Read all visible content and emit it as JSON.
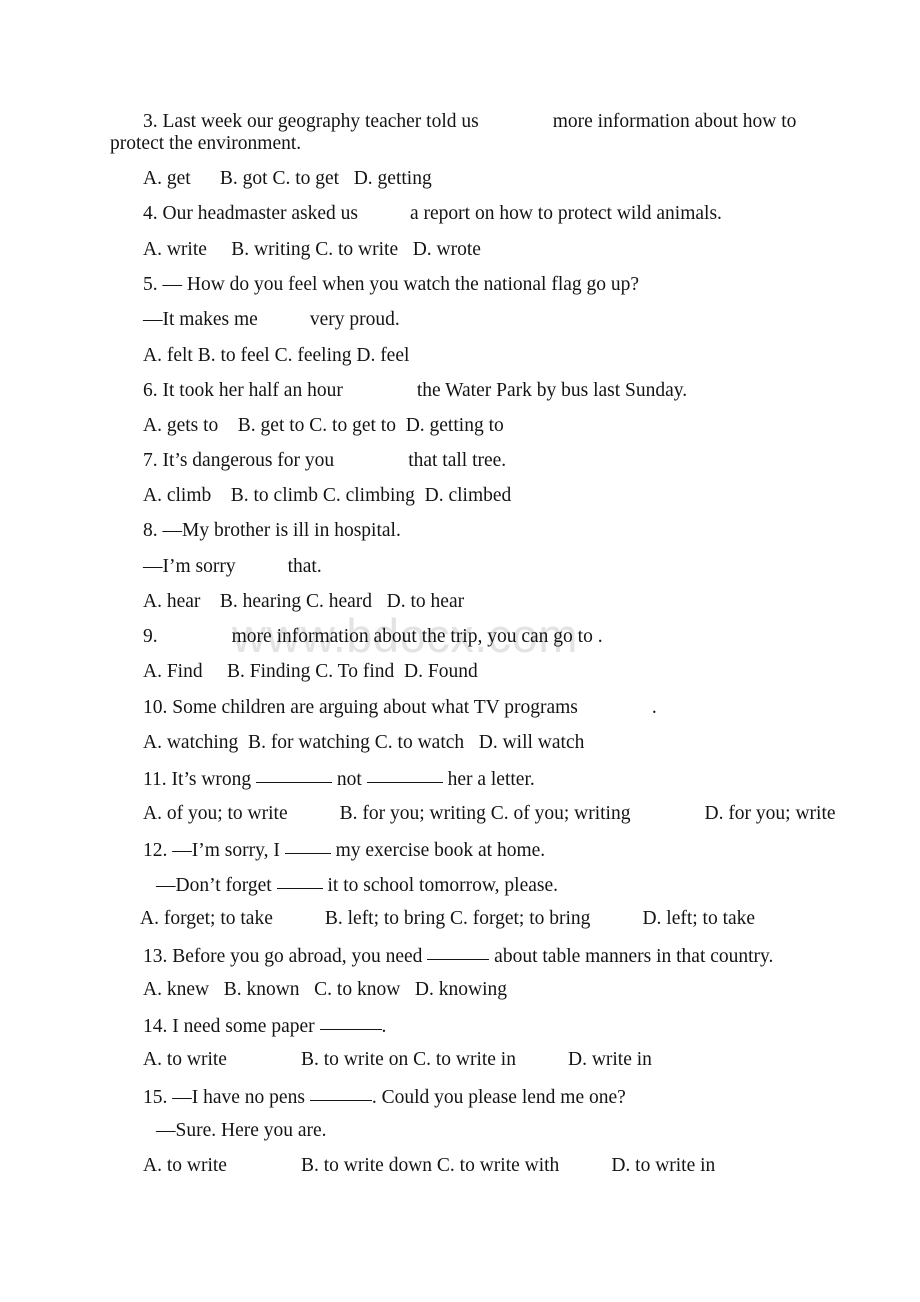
{
  "document": {
    "type": "scanned-exam-worksheet",
    "watermark": "www.bdocx.com",
    "watermark_color": "#e3e3e3",
    "text_color": "#141414",
    "background_color": "#ffffff"
  },
  "questions": [
    {
      "number": "3",
      "stem_part1": "3. Last week our geography teacher told us",
      "stem_part2": "more information about how to",
      "stem_wrap": "protect the environment.",
      "options": "A. get      B. got C. to get   D. getting"
    },
    {
      "number": "4",
      "stem_part1": "4. Our headmaster asked us",
      "stem_part2": "a report on how to protect wild animals.",
      "options": "A. write     B. writing C. to write   D. wrote"
    },
    {
      "number": "5",
      "stem_part1": "5. — How do you feel when you watch the national flag go up?",
      "reply_part1": "—It makes me",
      "reply_part2": "very proud.",
      "options": "A. felt B. to feel C. feeling D. feel"
    },
    {
      "number": "6",
      "stem_part1": "6. It took her half an hour",
      "stem_part2": "the Water Park by bus last Sunday.",
      "options": "A. gets to    B. get to C. to get to  D. getting to"
    },
    {
      "number": "7",
      "stem_part1": "7. It’s dangerous for you",
      "stem_part2": "that tall tree.",
      "options": "A. climb    B. to climb C. climbing  D. climbed"
    },
    {
      "number": "8",
      "stem_part1": "8. —My brother is ill in hospital.",
      "reply_part1": "—I’m sorry",
      "reply_part2": "that.",
      "options": "A. hear    B. hearing C. heard   D. to hear"
    },
    {
      "number": "9",
      "stem_part1": "9.",
      "stem_part2": "more information about the trip, you can go to .",
      "options": "A. Find     B. Finding C. To find  D. Found"
    },
    {
      "number": "10",
      "stem_part1": "10. Some children are arguing about what TV programs",
      "stem_part2": ".",
      "options": "A. watching  B. for watching C. to watch   D. will watch"
    },
    {
      "number": "11",
      "stem_pre": "11. It’s wrong ",
      "stem_mid": " not ",
      "stem_post": " her a letter.",
      "options_a": "A. of you; to write",
      "options_b": "B. for you; writing C. of you; writing",
      "options_d": "D. for you; write"
    },
    {
      "number": "12",
      "stem_pre": "12. —I’m sorry, I ",
      "stem_post": " my exercise book at home.",
      "reply_pre": "—Don’t forget ",
      "reply_post": " it to school tomorrow, please.",
      "options_a": "A. forget; to take",
      "options_b": "B. left; to bring C. forget; to bring",
      "options_d": "D. left; to take"
    },
    {
      "number": "13",
      "stem_pre": "13. Before you go abroad, you need ",
      "stem_post": " about table manners in that country.",
      "options": "A. knew   B. known   C. to know   D. knowing"
    },
    {
      "number": "14",
      "stem_pre": "14. I need some paper ",
      "stem_post": ".",
      "options_a": "A. to write",
      "options_b": "B. to write on C. to write in",
      "options_d": "D. write in"
    },
    {
      "number": "15",
      "stem_pre": "15. —I have no pens ",
      "stem_post": ". Could you please lend me one?",
      "reply": "—Sure. Here you are.",
      "options_a": "A. to write",
      "options_b": "B. to write down C. to write with",
      "options_d": "D. to write in"
    }
  ]
}
